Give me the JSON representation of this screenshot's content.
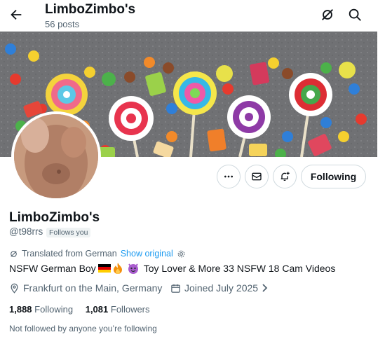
{
  "header": {
    "title": "LimboZimbo's",
    "posts_count": "56 posts"
  },
  "profile": {
    "display_name": "LimboZimbo's",
    "handle": "@t98rrs",
    "follows_you_badge": "Follows you",
    "translation": {
      "label": "Translated from German",
      "show_original": "Show original"
    },
    "bio": {
      "part1": "NSFW German Boy",
      "flag_emoji": "🇩🇪",
      "fire_emoji": "🔥",
      "devil_emoji": "😈",
      "part2": "Toy Lover & More 33 NSFW 18 Cam Videos"
    },
    "location": "Frankfurt on the Main, Germany",
    "joined": "Joined July 2025",
    "following_count": "1,888",
    "following_label": "Following",
    "followers_count": "1,081",
    "followers_label": "Followers",
    "not_followed_text": "Not followed by anyone you’re following"
  },
  "actions": {
    "following_button": "Following"
  }
}
